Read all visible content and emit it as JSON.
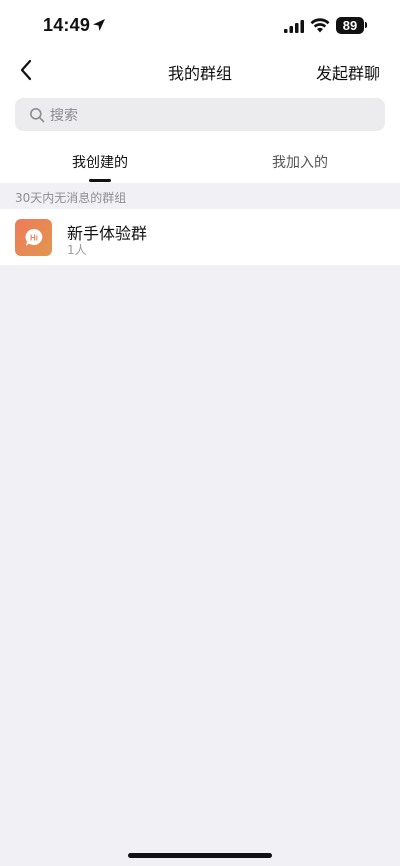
{
  "status_bar": {
    "time": "14:49",
    "battery": "89"
  },
  "nav": {
    "title": "我的群组",
    "action": "发起群聊"
  },
  "search": {
    "placeholder": "搜索"
  },
  "tabs": [
    {
      "label": "我创建的",
      "active": true
    },
    {
      "label": "我加入的",
      "active": false
    }
  ],
  "section": {
    "title": "30天内无消息的群组"
  },
  "groups": [
    {
      "name": "新手体验群",
      "members": "1人",
      "avatar_text": "Hi"
    }
  ],
  "colors": {
    "background": "#f1f0f5",
    "avatar_gradient_start": "#f07a5a",
    "avatar_gradient_end": "#e1974f"
  }
}
